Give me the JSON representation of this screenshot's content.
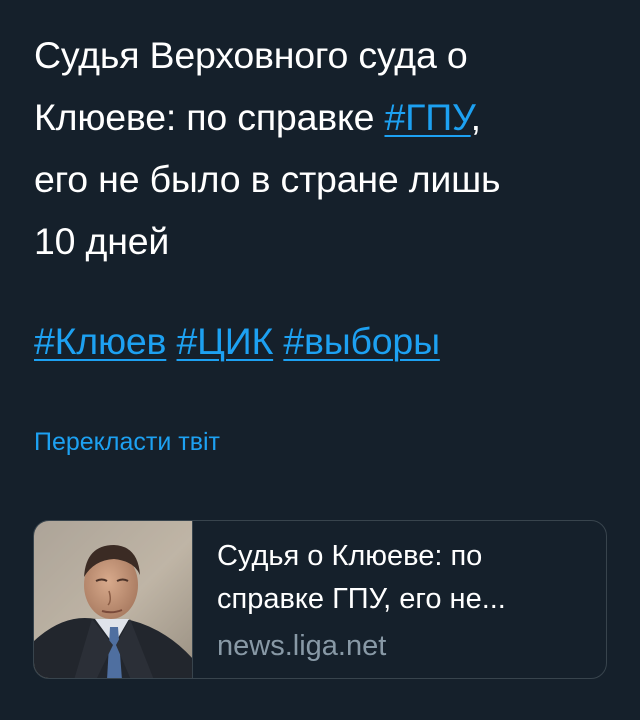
{
  "tweet": {
    "text_lines": [
      "Судья Верховного суда о",
      "Клюеве: по справке ",
      "его не было в стране лишь",
      "10 дней"
    ],
    "inline_hashtag": "#ГПУ",
    "inline_suffix": ",",
    "hashtags": [
      "#Клюев",
      "#ЦИК",
      "#выборы"
    ],
    "translate_label": "Перекласти твіт"
  },
  "card": {
    "title_lines": [
      "Судья о Клюеве: по",
      "справке ГПУ, его не..."
    ],
    "domain": "news.liga.net"
  },
  "colors": {
    "background": "#15202b",
    "link": "#1da1f2",
    "text": "#ffffff",
    "secondary_text": "#8899a6",
    "border": "#38444d"
  }
}
